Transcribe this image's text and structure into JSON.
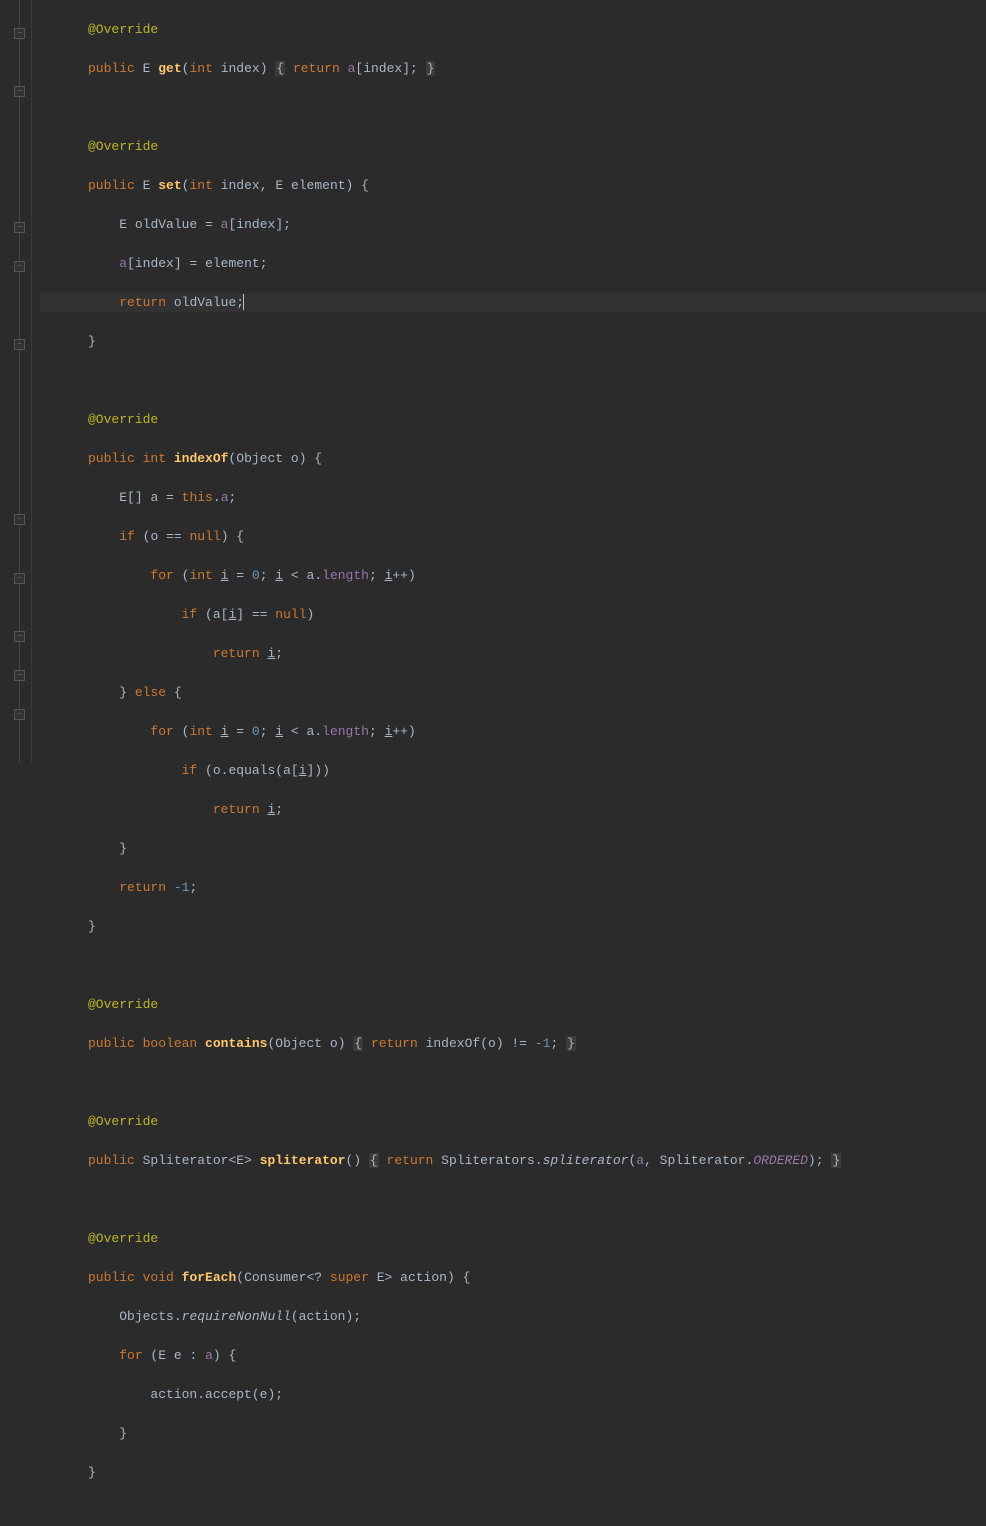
{
  "code": {
    "override": "@Override",
    "public": "public",
    "boolean": "boolean",
    "int_kw": "int",
    "void": "void",
    "return": "return",
    "if": "if",
    "else": "else",
    "for": "for",
    "this": "this",
    "null": "null",
    "super_kw": "super",
    "get": "get",
    "set": "set",
    "indexOf": "indexOf",
    "contains": "contains",
    "spliterator": "spliterator",
    "forEach": "forEach",
    "E": "E",
    "index": "index",
    "element": "element",
    "a": "a",
    "oldValue": "oldValue",
    "o": "o",
    "i": "i",
    "length": "length",
    "equals": "equals",
    "neg1": "-1",
    "zero": "0",
    "Object": "Object",
    "Spliterator": "Spliterator",
    "Spliterators": "Spliterators",
    "spliterator_call": "spliterator",
    "ORDERED": "ORDERED",
    "Consumer": "Consumer",
    "action": "action",
    "Objects": "Objects",
    "requireNonNull": "requireNonNull",
    "accept": "accept",
    "e": "e"
  }
}
